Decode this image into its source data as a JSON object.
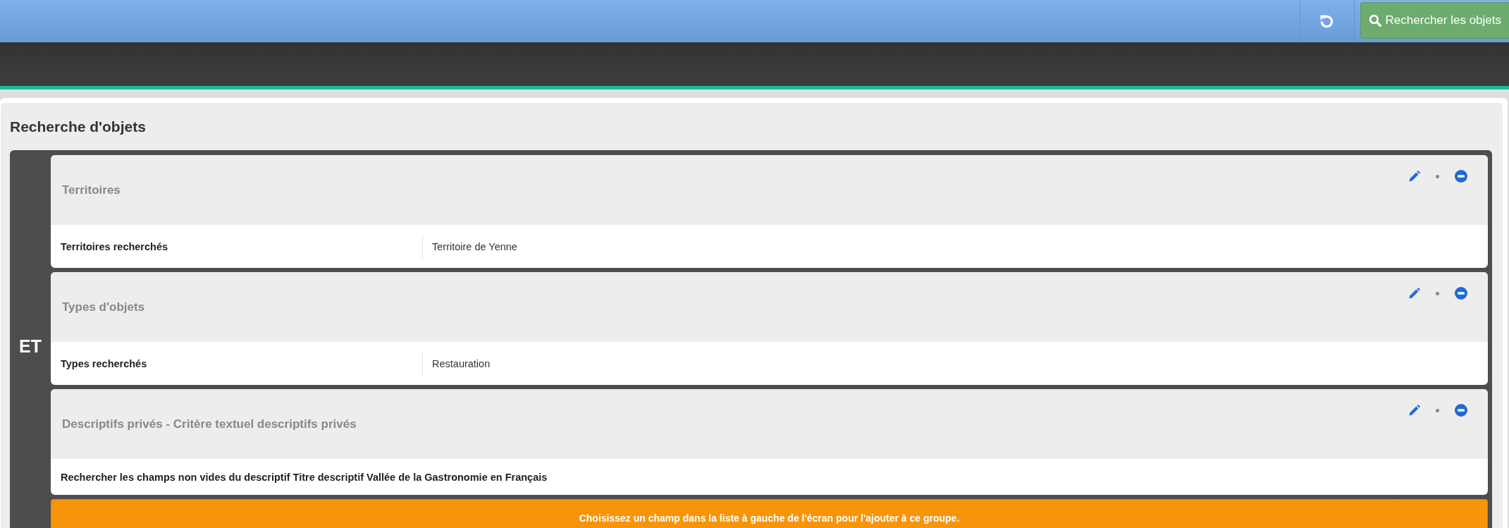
{
  "toolbar": {
    "search_button": "Rechercher les objets"
  },
  "page": {
    "title": "Recherche d'objets"
  },
  "group": {
    "operator": "ET",
    "criteria": [
      {
        "kind": "pair",
        "title": "Territoires",
        "label": "Territoires recherchés",
        "value": "Territoire de Yenne"
      },
      {
        "kind": "pair",
        "title": "Types d'objets",
        "label": "Types recherchés",
        "value": "Restauration"
      },
      {
        "kind": "text",
        "title": "Descriptifs privés - Critère textuel descriptifs privés",
        "text": "Rechercher les champs non vides du descriptif Titre descriptif Vallée de la Gastronomie en Français"
      }
    ],
    "drop_hint": "Choisissez un champ dans la liste à gauche de l'écran pour l'ajouter à ce groupe."
  }
}
